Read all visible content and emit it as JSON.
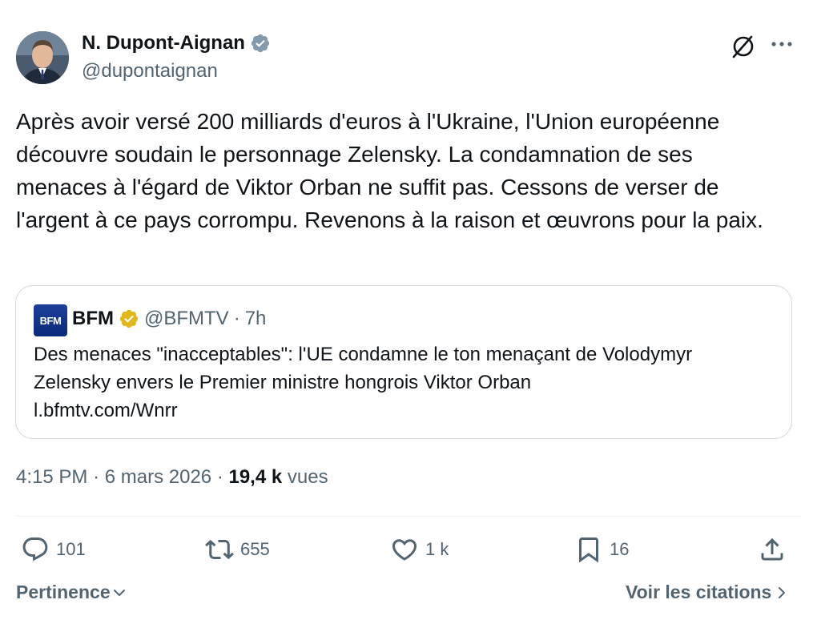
{
  "author": {
    "name": "N. Dupont-Aignan",
    "handle": "@dupontaignan",
    "verified_color": "#829aab"
  },
  "tweet": {
    "text": "Après avoir versé 200 milliards d'euros à l'Ukraine, l'Union européenne découvre soudain le personnage Zelensky. La condamnation de ses menaces à l'égard de Viktor Orban ne suffit pas. Cessons de verser de l'argent à ce pays corrompu. Revenons à la raison et œuvrons pour la paix."
  },
  "quote": {
    "logo_text": "BFM",
    "name": "BFM",
    "handle": "@BFMTV",
    "separator": "·",
    "time": "7h",
    "text_line1": "Des menaces \"inacceptables\": l'UE condamne le ton menaçant de Volodymyr",
    "text_line2": "Zelensky envers le Premier ministre hongrois Viktor Orban",
    "link": "l.bfmtv.com/Wnrr",
    "verified_color": "#e2b719"
  },
  "meta": {
    "time": "4:15 PM",
    "sep1": "·",
    "date": "6 mars 2026",
    "sep2": "·",
    "views_count": "19,4 k",
    "views_label": "vues"
  },
  "actions": {
    "replies": "101",
    "reposts": "655",
    "likes": "1 k",
    "bookmarks": "16"
  },
  "footer": {
    "sort_label": "Pertinence",
    "citations_label": "Voir les citations"
  },
  "icons": {
    "grok": "slashed-circle-icon",
    "more": "more-icon",
    "reply": "reply-icon",
    "repost": "repost-icon",
    "like": "heart-icon",
    "bookmark": "bookmark-icon",
    "share": "share-icon"
  },
  "colors": {
    "text": "#0f1419",
    "secondary": "#536471",
    "border": "#cfd9de"
  }
}
